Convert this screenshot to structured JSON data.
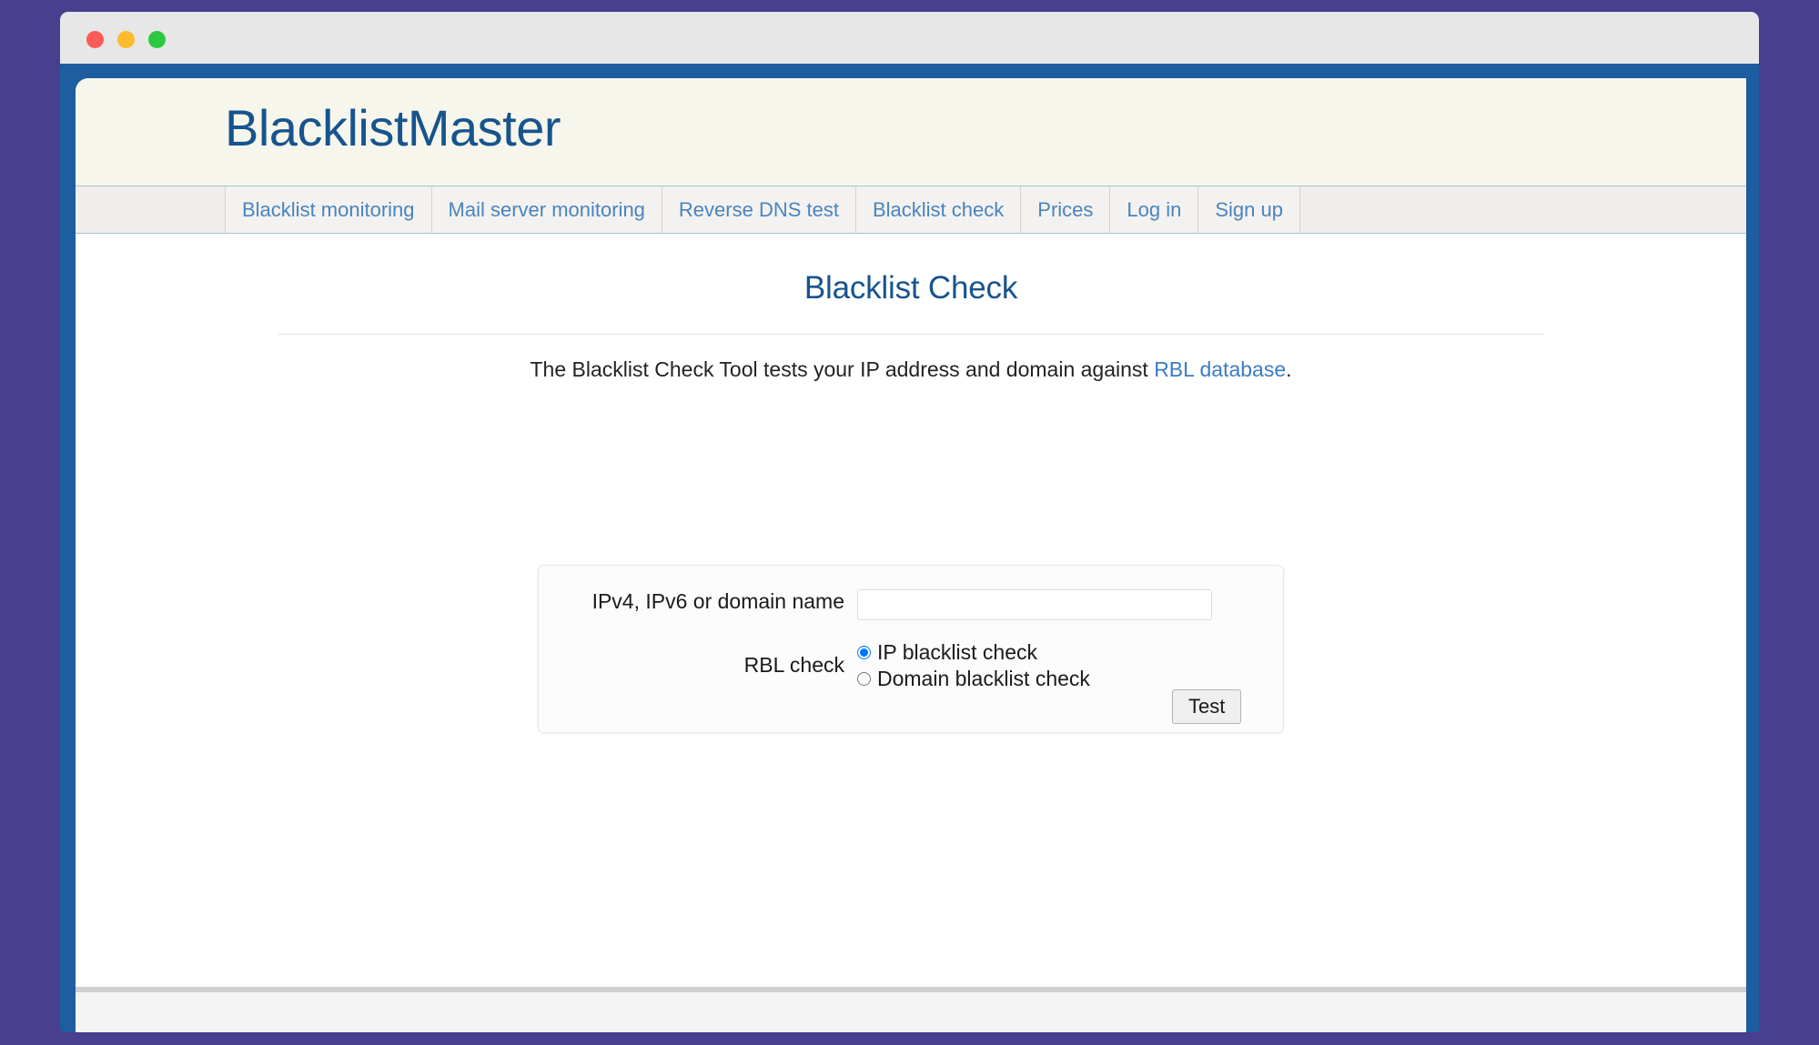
{
  "window": {
    "traffic_lights": [
      {
        "name": "close",
        "color": "#fc5b57"
      },
      {
        "name": "minimize",
        "color": "#fdbc2d"
      },
      {
        "name": "maximize",
        "color": "#2bc840"
      }
    ]
  },
  "site": {
    "logo": "BlacklistMaster",
    "brand_color": "#17548e",
    "header_bg": "#f7f6ec",
    "chrome_color": "#1c5e9f",
    "desktop_bg": "#483f8e"
  },
  "nav": {
    "items": [
      {
        "label": "Blacklist monitoring"
      },
      {
        "label": "Mail server monitoring"
      },
      {
        "label": "Reverse DNS test"
      },
      {
        "label": "Blacklist check"
      },
      {
        "label": "Prices"
      },
      {
        "label": "Log in"
      },
      {
        "label": "Sign up"
      }
    ]
  },
  "page": {
    "title": "Blacklist Check",
    "intro_prefix": "The Blacklist Check Tool tests your IP address and domain against ",
    "intro_link": "RBL database",
    "intro_suffix": "."
  },
  "form": {
    "host_label": "IPv4, IPv6 or domain name",
    "host_value": "",
    "host_placeholder": "",
    "rbl_label": "RBL check",
    "rbl_options": [
      {
        "label": "IP blacklist check",
        "selected": true
      },
      {
        "label": "Domain blacklist check",
        "selected": false
      }
    ],
    "submit_label": "Test"
  }
}
